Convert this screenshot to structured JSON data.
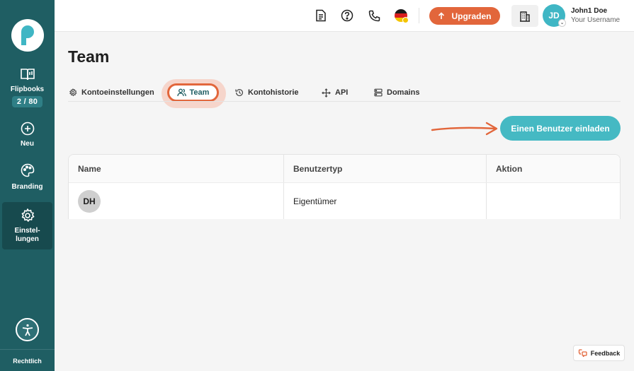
{
  "sidebar": {
    "items": [
      {
        "label": "Flipbooks",
        "badge": "2 / 80",
        "icon": "book-icon"
      },
      {
        "label": "Neu",
        "icon": "plus-circle-icon"
      },
      {
        "label": "Branding",
        "icon": "palette-icon"
      },
      {
        "label": "Einstel-\nlungen",
        "label_line1": "Einstel-",
        "label_line2": "lungen",
        "icon": "gear-icon",
        "active": true
      }
    ],
    "legal": "Rechtlich"
  },
  "header": {
    "upgrade_label": "Upgraden",
    "user_initials": "JD",
    "user_name": "John1 Doe",
    "user_sub": "Your Username"
  },
  "page": {
    "title": "Team",
    "tabs": [
      {
        "label": "Kontoeinstellungen",
        "icon": "gear-icon"
      },
      {
        "label": "Team",
        "icon": "users-icon",
        "active": true
      },
      {
        "label": "Kontohistorie",
        "icon": "history-icon"
      },
      {
        "label": "API",
        "icon": "move-icon"
      },
      {
        "label": "Domains",
        "icon": "server-icon"
      }
    ],
    "invite_label": "Einen Benutzer einladen"
  },
  "table": {
    "headers": [
      "Name",
      "Benutzertyp",
      "Aktion"
    ],
    "rows": [
      {
        "initials": "DH",
        "type": "Eigentümer",
        "action": ""
      }
    ]
  },
  "feedback_label": "Feedback",
  "colors": {
    "sidebar": "#1f5e63",
    "accent": "#e2663b",
    "primary": "#45b9c3"
  }
}
